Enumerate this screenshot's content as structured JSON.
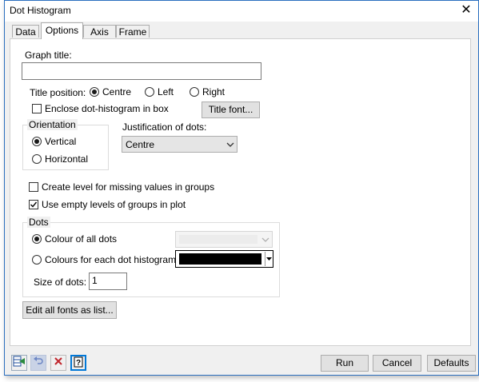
{
  "window": {
    "title": "Dot Histogram",
    "close_glyph": "✕"
  },
  "tabs": [
    {
      "label": "Data",
      "active": false
    },
    {
      "label": "Options",
      "active": true
    },
    {
      "label": "Axis",
      "active": false
    },
    {
      "label": "Frame",
      "active": false
    }
  ],
  "options": {
    "graph_title_label": "Graph title:",
    "graph_title_value": "",
    "title_position_label": "Title position:",
    "title_position": {
      "centre": "Centre",
      "left": "Left",
      "right": "Right",
      "selected": "Centre"
    },
    "enclose_label": "Enclose dot-histogram in box",
    "enclose_checked": false,
    "title_font_button": "Title font...",
    "orientation_label": "Orientation",
    "vertical_label": "Vertical",
    "horizontal_label": "Horizontal",
    "orientation_selected": "Vertical",
    "justification_label": "Justification of dots:",
    "justification_value": "Centre",
    "missing_levels_label": "Create level for missing values in groups",
    "missing_levels_checked": false,
    "empty_levels_label": "Use empty levels of groups in plot",
    "empty_levels_checked": true,
    "dots_label": "Dots",
    "colour_all_label": "Colour of all dots",
    "colour_each_label": "Colours for each dot histogram",
    "colour_selected": "all",
    "colour_each_swatch": "#000000",
    "size_label": "Size of dots:",
    "size_value": "1",
    "edit_fonts_button": "Edit all fonts as list..."
  },
  "footer": {
    "icons": [
      "send-to-spreadsheet-icon",
      "undo-icon",
      "clear-icon",
      "help-icon"
    ],
    "run_button": "Run",
    "cancel_button": "Cancel",
    "defaults_button": "Defaults"
  },
  "colors": {
    "accent": "#0078d7",
    "window_border": "#2b6fbf",
    "clear_red": "#c0262d"
  }
}
